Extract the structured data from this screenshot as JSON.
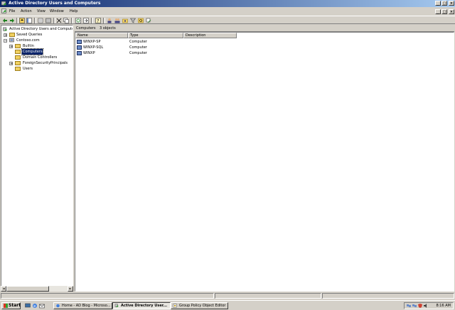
{
  "window": {
    "title": "Active Directory Users and Computers",
    "controls": {
      "minimize": "_",
      "restore": "□",
      "close": "×"
    }
  },
  "menu": {
    "items": [
      {
        "label": "File"
      },
      {
        "label": "Action"
      },
      {
        "label": "View"
      },
      {
        "label": "Window"
      },
      {
        "label": "Help"
      }
    ],
    "child_controls": {
      "minimize": "_",
      "restore": "□",
      "close": "×"
    }
  },
  "toolbar": {
    "icons": [
      "back-icon",
      "forward-icon",
      "up-icon",
      "show-console-tree-icon",
      "properties-icon",
      "delete-icon",
      "cut-icon",
      "copy-icon",
      "refresh-icon",
      "export-list-icon",
      "help-icon",
      "new-user-icon",
      "new-group-icon",
      "new-ou-icon",
      "filter-icon",
      "find-icon",
      "add-to-group-icon"
    ]
  },
  "tree": {
    "root": "Active Directory Users and Computer",
    "nodes": [
      {
        "label": "Saved Queries",
        "expander": "+"
      },
      {
        "label": "Contoso.com",
        "expander": "−"
      },
      {
        "label": "Builtin",
        "expander": "+"
      },
      {
        "label": "Computers",
        "expander": "",
        "selected": true
      },
      {
        "label": "Domain Controllers",
        "expander": ""
      },
      {
        "label": "ForeignSecurityPrincipals",
        "expander": "+"
      },
      {
        "label": "Users",
        "expander": ""
      }
    ]
  },
  "content": {
    "header_title": "Computers",
    "header_count": "3 objects",
    "columns": [
      "Name",
      "Type",
      "Description"
    ],
    "rows": [
      {
        "name": "WINXP-SP",
        "type": "Computer",
        "description": ""
      },
      {
        "name": "WINXP-SQL",
        "type": "Computer",
        "description": ""
      },
      {
        "name": "WINXP",
        "type": "Computer",
        "description": ""
      }
    ]
  },
  "scrollbar": {
    "left_arrow": "◄",
    "right_arrow": "►"
  },
  "taskbar": {
    "start_label": "Start",
    "tasks": [
      {
        "label": "Home - AD Blog - Microso...",
        "active": false
      },
      {
        "label": "Active Directory User...",
        "active": true
      },
      {
        "label": "Group Policy Object Editor",
        "active": false
      }
    ],
    "clock": "8:16 AM"
  },
  "colors": {
    "title_start": "#0a246a",
    "title_end": "#a6caf0",
    "face": "#d4d0c8",
    "selection": "#0a246a"
  }
}
